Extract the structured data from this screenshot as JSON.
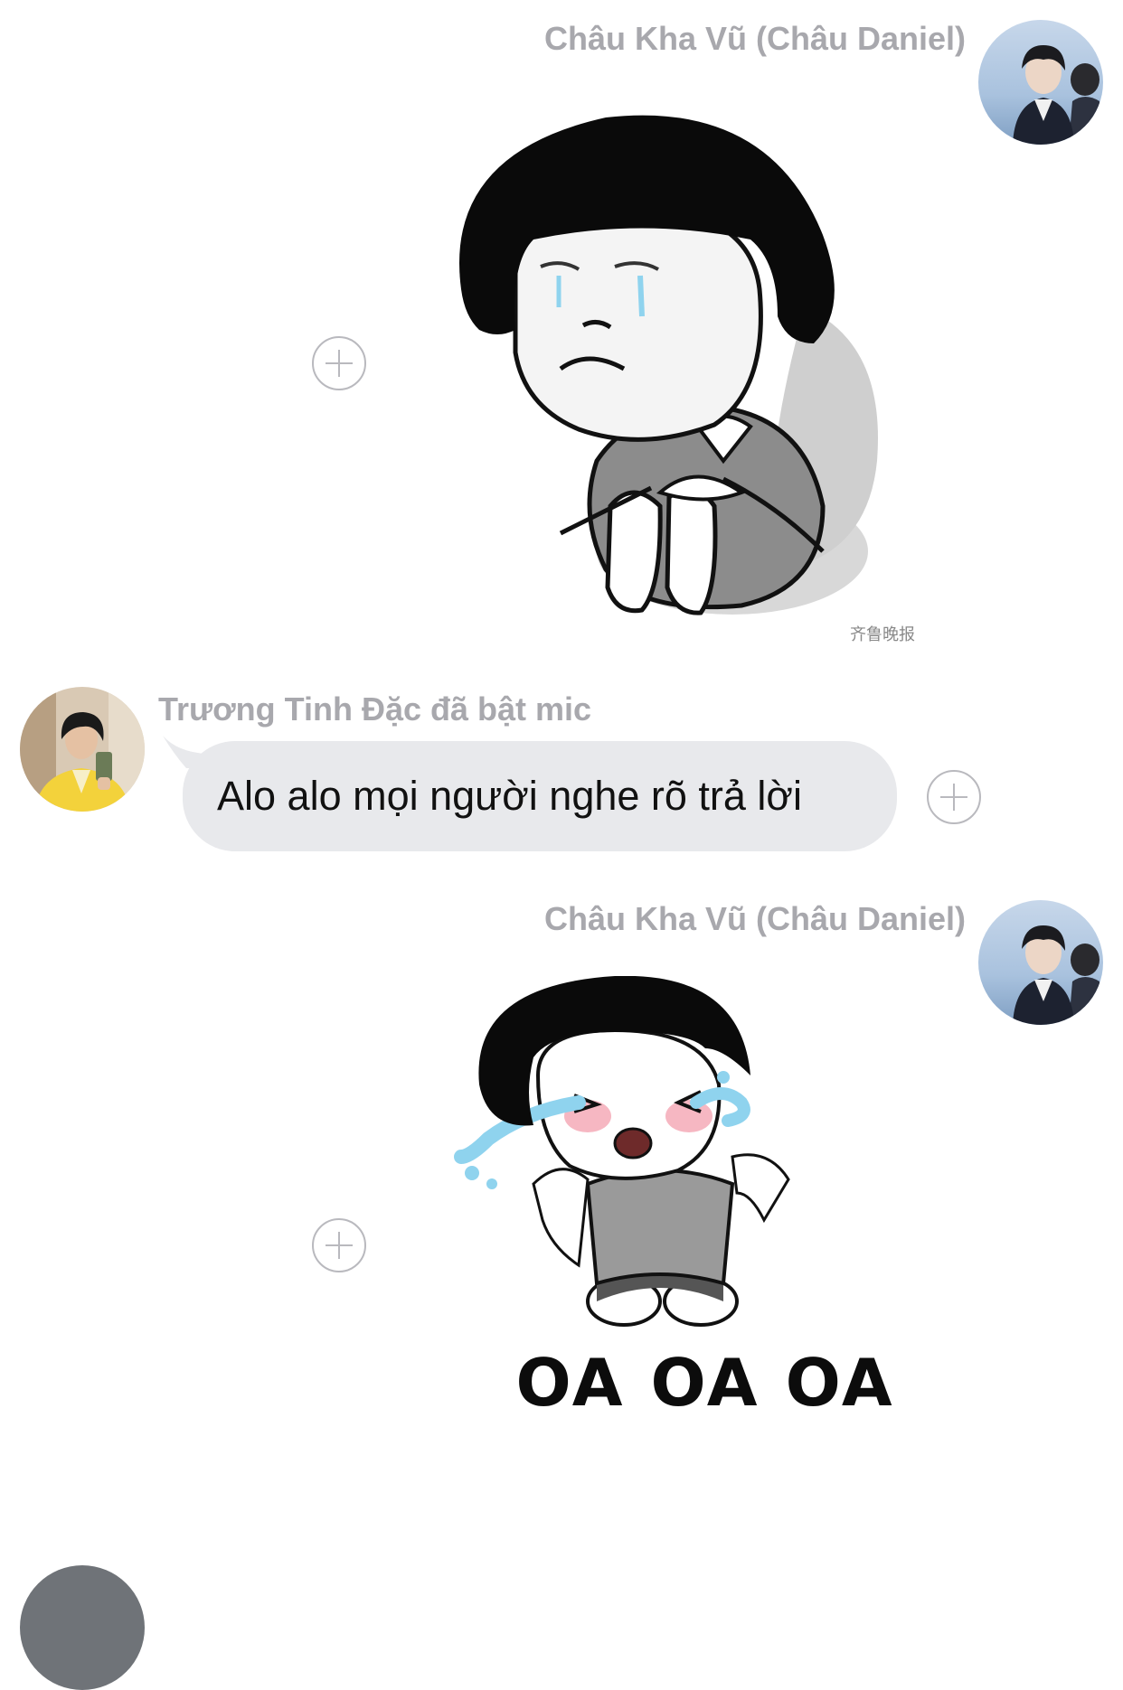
{
  "messages": [
    {
      "sender": "Châu Kha Vũ (Châu Daniel)",
      "type": "sticker",
      "sticker": "crying-bowl-cut-sitting",
      "watermark": "齐鲁晚报"
    },
    {
      "sender": "Trương Tinh Đặc đã bật mic",
      "type": "text",
      "text": "Alo alo mọi người nghe rõ trả lời"
    },
    {
      "sender": "Châu Kha Vũ (Châu Daniel)",
      "type": "sticker",
      "sticker": "crying-bowl-cut-tissues",
      "caption": "OA OA OA"
    }
  ],
  "icons": {
    "add_reaction": "plus-circle-icon"
  },
  "colors": {
    "bubble_bg": "#e8e9ec",
    "name_gray": "#a8a8ad",
    "tear_blue": "#8fd3ee"
  }
}
